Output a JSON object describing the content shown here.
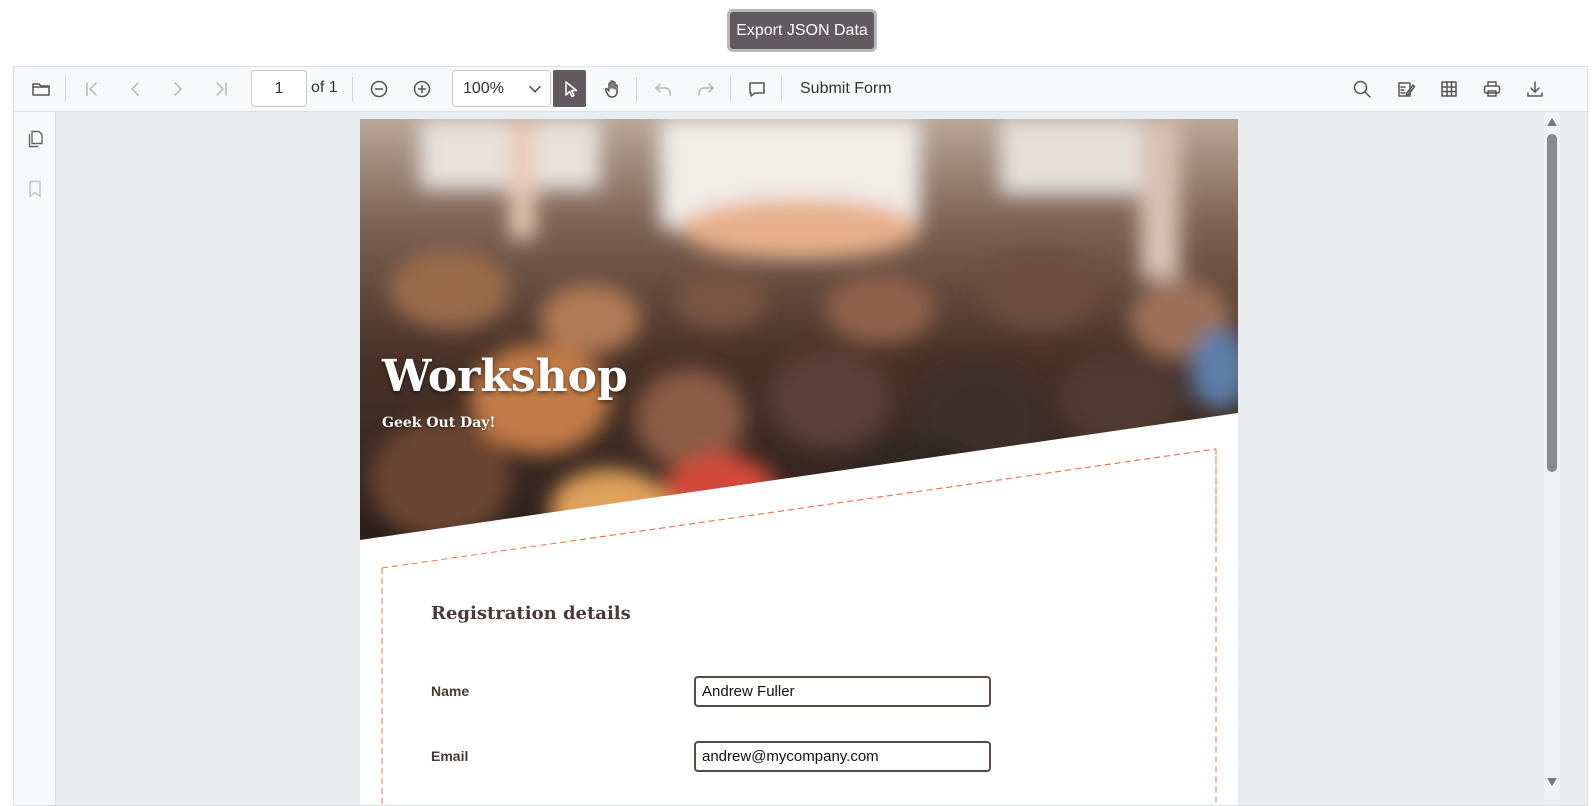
{
  "export_button": {
    "label": "Export JSON Data"
  },
  "toolbar": {
    "page_number": "1",
    "page_of": "of 1",
    "zoom": "100%",
    "submit_label": "Submit Form"
  },
  "document": {
    "hero_title": "Workshop",
    "hero_subtitle": "Geek Out Day!",
    "section_title": "Registration details",
    "fields": [
      {
        "label": "Name",
        "value": "Andrew Fuller"
      },
      {
        "label": "Email",
        "value": "andrew@mycompany.com"
      }
    ]
  },
  "colors": {
    "accent": "#615a5e",
    "form_border_dashed": "#e07a4f",
    "text_brown": "#4a3a34"
  }
}
